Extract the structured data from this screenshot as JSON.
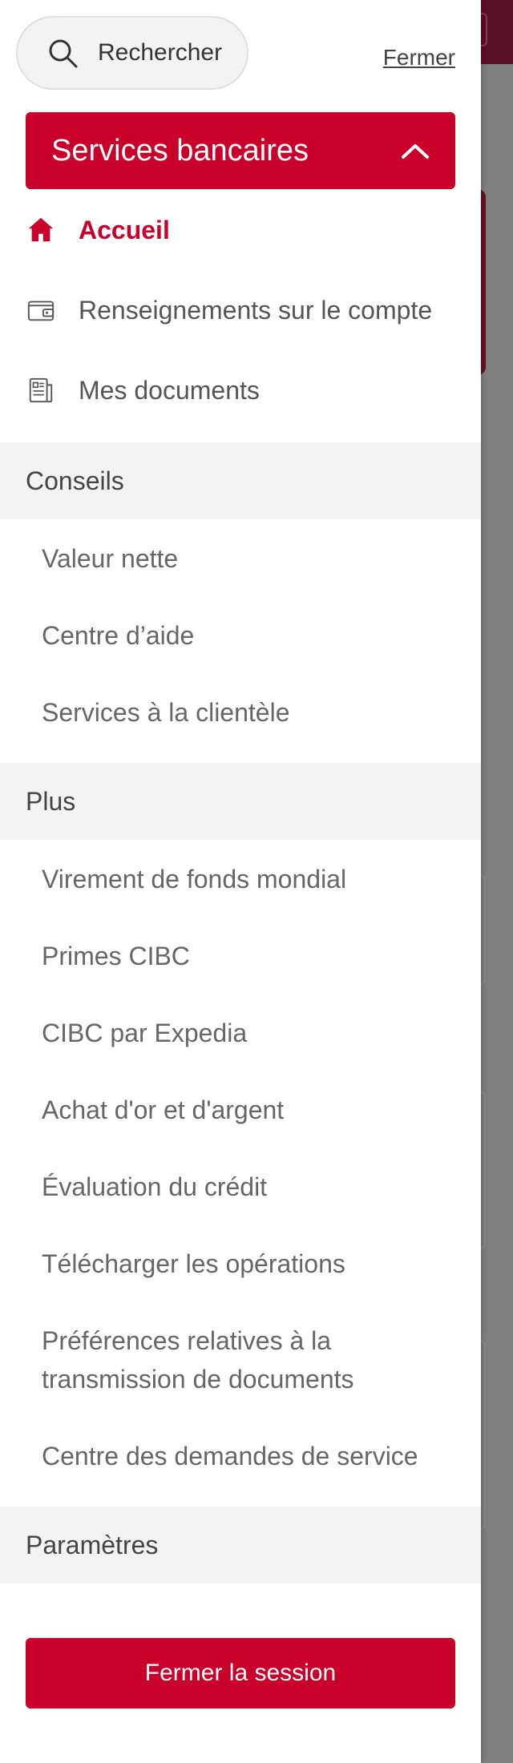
{
  "search": {
    "label": "Rechercher",
    "icon": "search-icon"
  },
  "close_label": "Fermer",
  "banking_section": {
    "title": "Services bancaires",
    "icon": "chevron-up-icon",
    "items": [
      {
        "label": "Accueil",
        "icon": "home-icon",
        "active": true
      },
      {
        "label": "Renseignements sur le compte",
        "icon": "wallet-icon",
        "active": false
      },
      {
        "label": "Mes documents",
        "icon": "documents-icon",
        "active": false
      }
    ]
  },
  "groups": {
    "conseils": {
      "label": "Conseils",
      "items": [
        "Valeur nette",
        "Centre d’aide",
        "Services à la clientèle"
      ]
    },
    "plus": {
      "label": "Plus",
      "items": [
        "Virement de fonds mondial",
        "Primes CIBC",
        "CIBC par Expedia",
        "Achat d'or et d'argent",
        "Évaluation du crédit",
        "Télécharger les opérations",
        "Préférences relatives à la transmission de documents",
        "Centre des demandes de service"
      ]
    },
    "parametres": {
      "label": "Paramètres"
    }
  },
  "logout_label": "Fermer la session",
  "colors": {
    "brand_red": "#c8002a",
    "group_bg": "#f3f3f3",
    "text": "#555555"
  }
}
